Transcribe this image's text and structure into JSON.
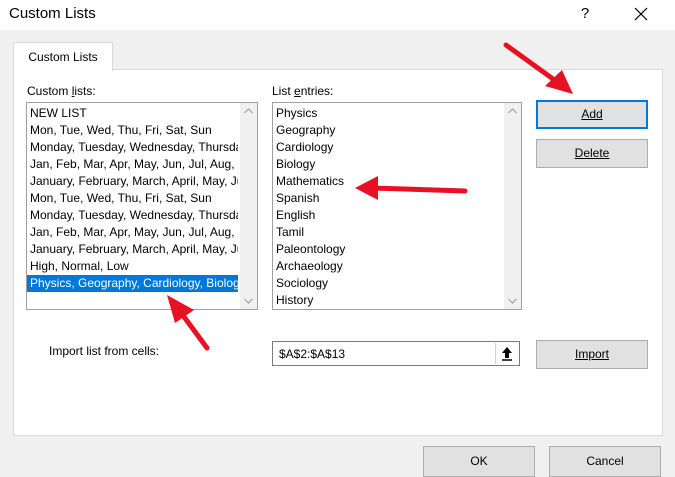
{
  "window": {
    "title": "Custom Lists",
    "help_label": "?"
  },
  "tabs": [
    {
      "label": "Custom Lists"
    }
  ],
  "custom_lists": {
    "label_prefix": "Custom ",
    "label_mnemonic": "l",
    "label_suffix": "ists:",
    "items": [
      "NEW LIST",
      "Mon, Tue, Wed, Thu, Fri, Sat, Sun",
      "Monday, Tuesday, Wednesday, Thursday, Friday, Saturday, Sunday",
      "Jan, Feb, Mar, Apr, May, Jun, Jul, Aug, Sep, Oct, Nov, Dec",
      "January, February, March, April, May, June, July, August, September, October, November, December",
      "Mon, Tue, Wed, Thu, Fri, Sat, Sun",
      "Monday, Tuesday, Wednesday, Thursday, Friday, Saturday, Sunday",
      "Jan, Feb, Mar, Apr, May, Jun, Jul, Aug, Sep, Oct, Nov, Dec",
      "January, February, March, April, May, June, July, August, September, October, November, December",
      "High, Normal, Low",
      "Physics, Geography, Cardiology, Biology, Mathematics, Spanish, English, Tamil, Paleontology, Archaeology, Sociology, History"
    ],
    "selected_index": 10
  },
  "list_entries": {
    "label_prefix": "List ",
    "label_mnemonic": "e",
    "label_suffix": "ntries:",
    "items": [
      "Physics",
      "Geography",
      "Cardiology",
      "Biology",
      "Mathematics",
      "Spanish",
      "English",
      "Tamil",
      "Paleontology",
      "Archaeology",
      "Sociology",
      "History"
    ]
  },
  "buttons": {
    "add": "Add",
    "delete": "Delete",
    "import": "Import",
    "ok": "OK",
    "cancel": "Cancel"
  },
  "import": {
    "label": "Import list from cells:",
    "value": "$A$2:$A$13"
  },
  "colors": {
    "selection": "#0078d7",
    "annotation_arrow": "#e81123"
  }
}
